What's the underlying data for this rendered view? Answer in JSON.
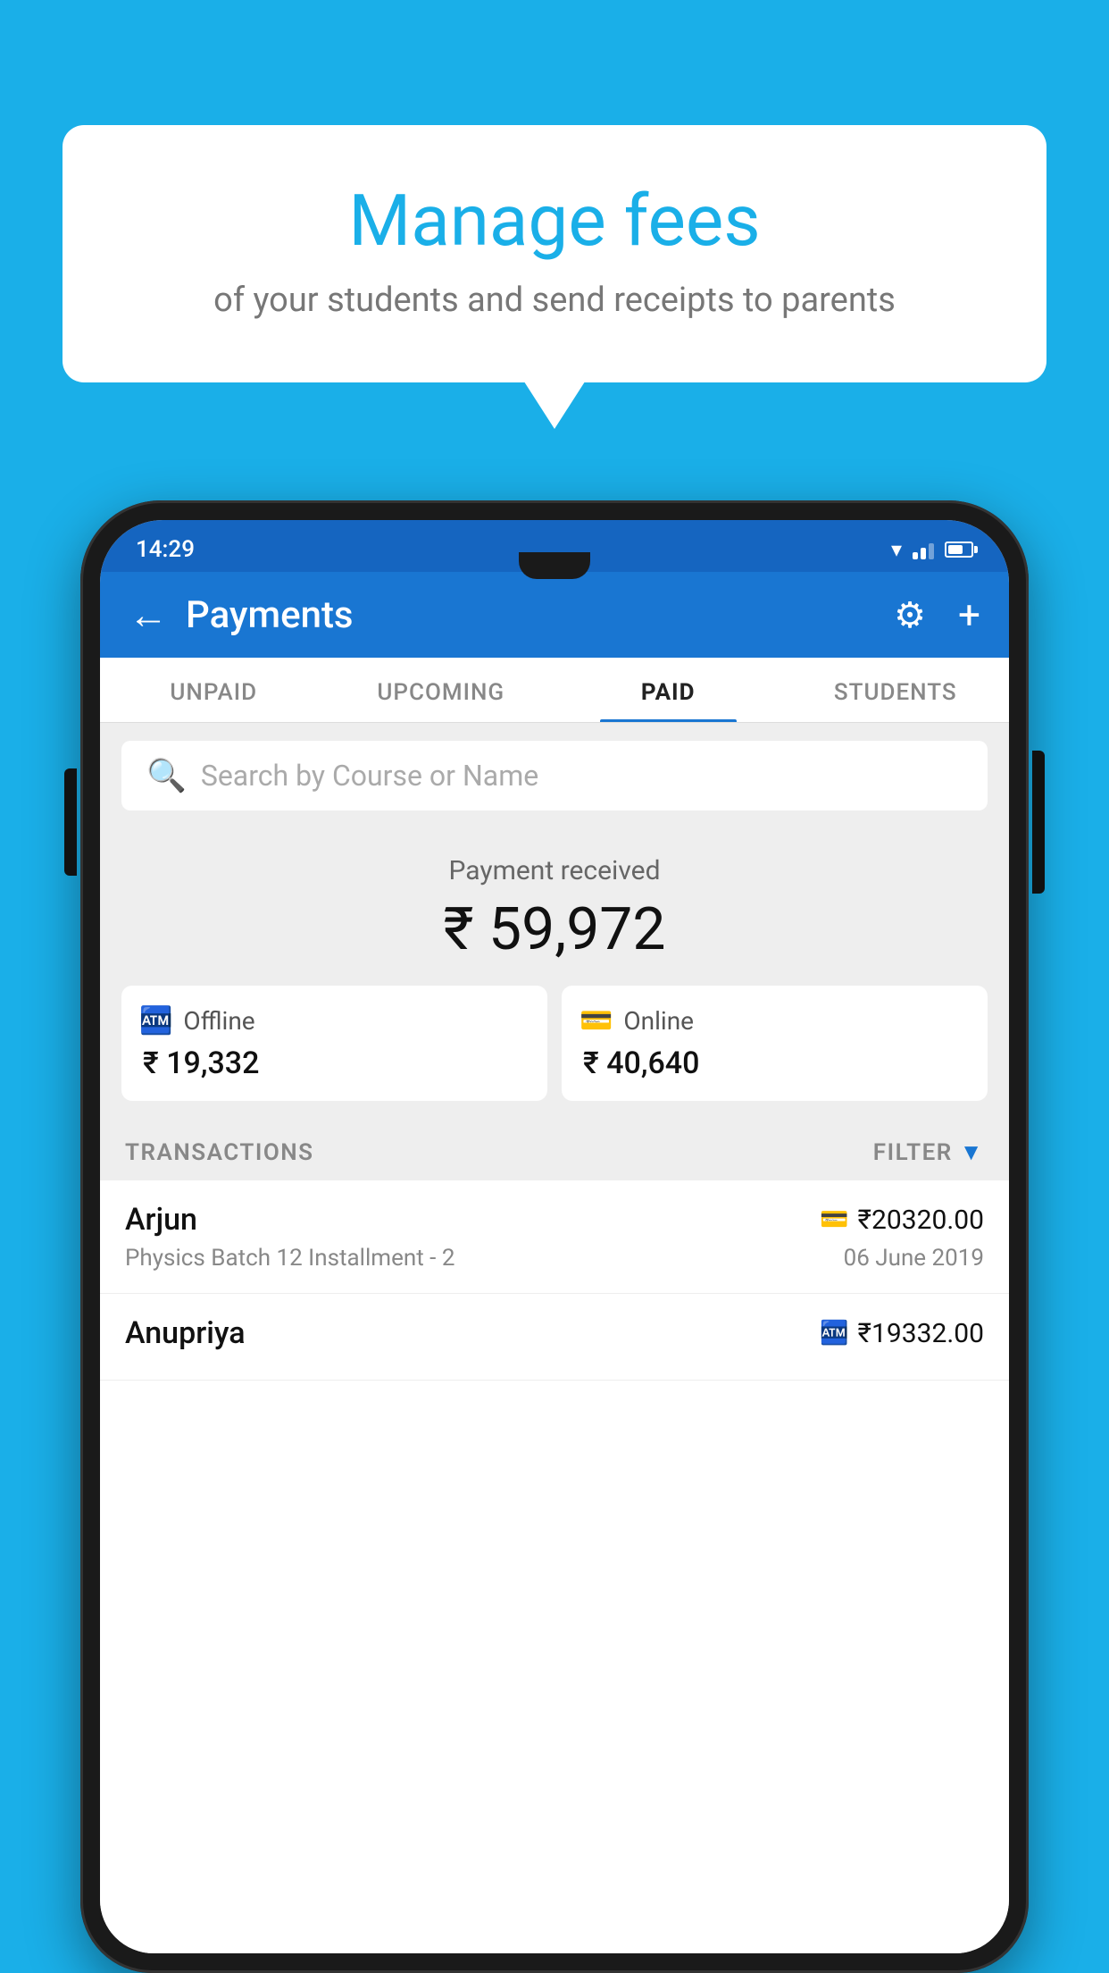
{
  "background_color": "#1AAFE8",
  "bubble": {
    "title": "Manage fees",
    "subtitle": "of your students and send receipts to parents"
  },
  "status_bar": {
    "time": "14:29"
  },
  "app_bar": {
    "title": "Payments",
    "back_label": "←",
    "gear_label": "⚙",
    "plus_label": "+"
  },
  "tabs": [
    {
      "label": "UNPAID",
      "active": false
    },
    {
      "label": "UPCOMING",
      "active": false
    },
    {
      "label": "PAID",
      "active": true
    },
    {
      "label": "STUDENTS",
      "active": false
    }
  ],
  "search": {
    "placeholder": "Search by Course or Name"
  },
  "payment": {
    "received_label": "Payment received",
    "amount": "₹ 59,972",
    "offline_label": "Offline",
    "offline_amount": "₹ 19,332",
    "online_label": "Online",
    "online_amount": "₹ 40,640"
  },
  "transactions": {
    "header_label": "TRANSACTIONS",
    "filter_label": "FILTER",
    "items": [
      {
        "name": "Arjun",
        "amount": "₹20320.00",
        "course": "Physics Batch 12 Installment - 2",
        "date": "06 June 2019",
        "type": "online"
      },
      {
        "name": "Anupriya",
        "amount": "₹19332.00",
        "course": "",
        "date": "",
        "type": "offline"
      }
    ]
  }
}
